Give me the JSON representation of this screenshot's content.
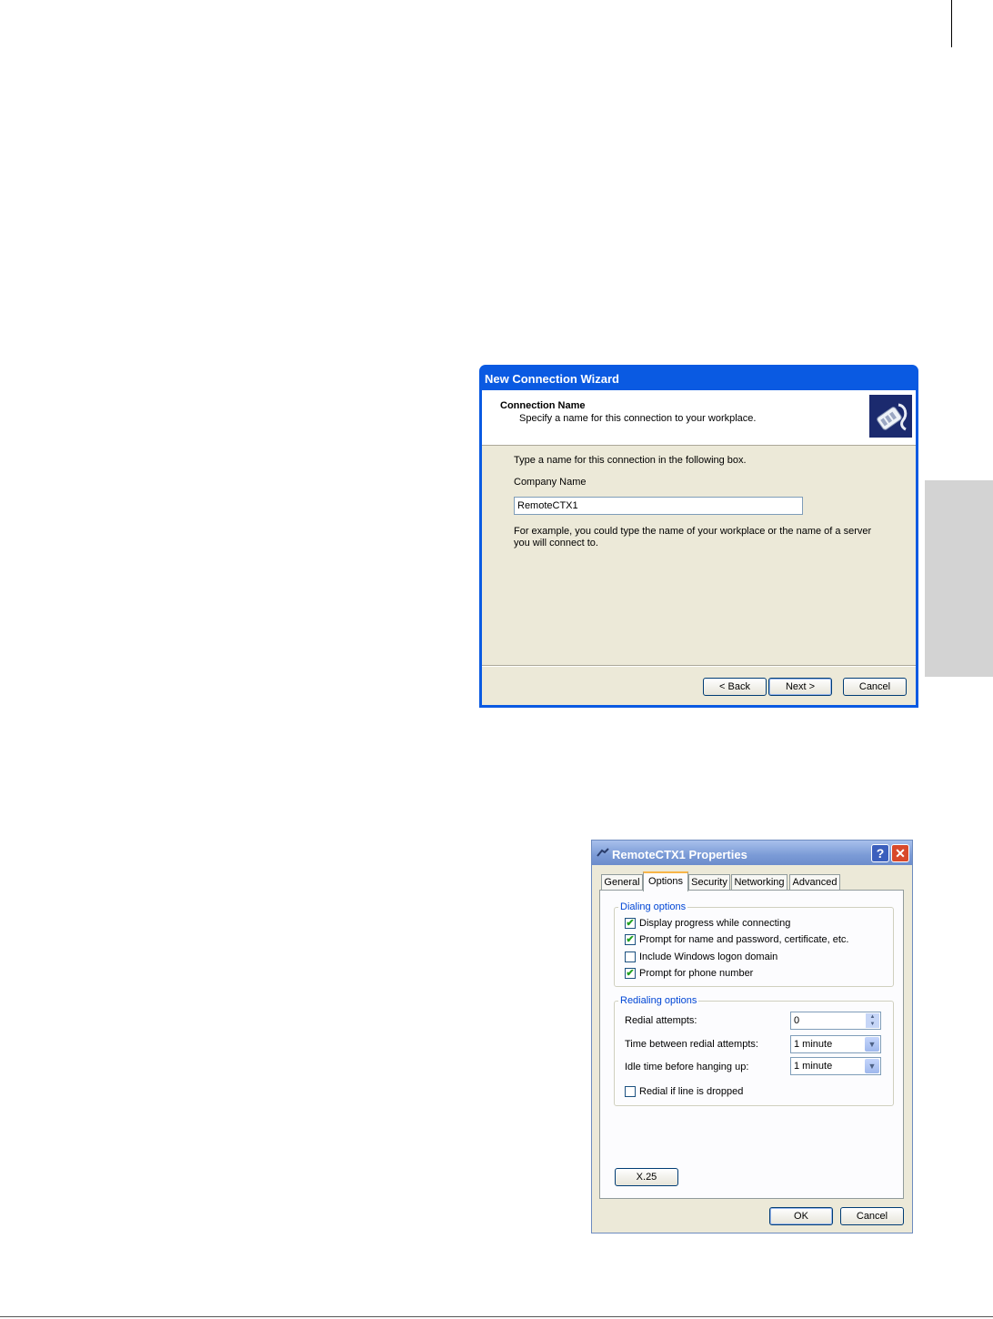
{
  "wizard": {
    "title": "New Connection Wizard",
    "header_title": "Connection Name",
    "header_subtitle": "Specify a name for this connection to your workplace.",
    "instruction": "Type a name for this connection in the following box.",
    "field_label": "Company Name",
    "field_value": "RemoteCTX1",
    "note": "For example, you could type the name of your workplace or the name of a server you will connect to.",
    "back_label": "< Back",
    "next_label": "Next >",
    "cancel_label": "Cancel",
    "icon": "phone-connection-icon"
  },
  "properties": {
    "title": "RemoteCTX1 Properties",
    "help_glyph": "?",
    "close_glyph": "✕",
    "tabs": [
      "General",
      "Options",
      "Security",
      "Networking",
      "Advanced"
    ],
    "active_tab": "Options",
    "dialing_group_label": "Dialing options",
    "dialing_options": [
      {
        "label": "Display progress while connecting",
        "checked": true
      },
      {
        "label": "Prompt for name and password, certificate, etc.",
        "checked": true
      },
      {
        "label": "Include Windows logon domain",
        "checked": false
      },
      {
        "label": "Prompt for phone number",
        "checked": true
      }
    ],
    "redialing_group_label": "Redialing options",
    "redial_attempts_label": "Redial attempts:",
    "redial_attempts_value": "0",
    "time_between_label": "Time between redial attempts:",
    "time_between_value": "1 minute",
    "idle_time_label": "Idle time before hanging up:",
    "idle_time_value": "1 minute",
    "redial_dropped_label": "Redial if line is dropped",
    "redial_dropped_checked": false,
    "x25_label": "X.25",
    "ok_label": "OK",
    "cancel_label": "Cancel"
  },
  "colors": {
    "xp_blue_title": "#0a5ae2",
    "dialog_face": "#ece9d8",
    "group_label": "#0046d5",
    "check_mark": "#21a121"
  }
}
